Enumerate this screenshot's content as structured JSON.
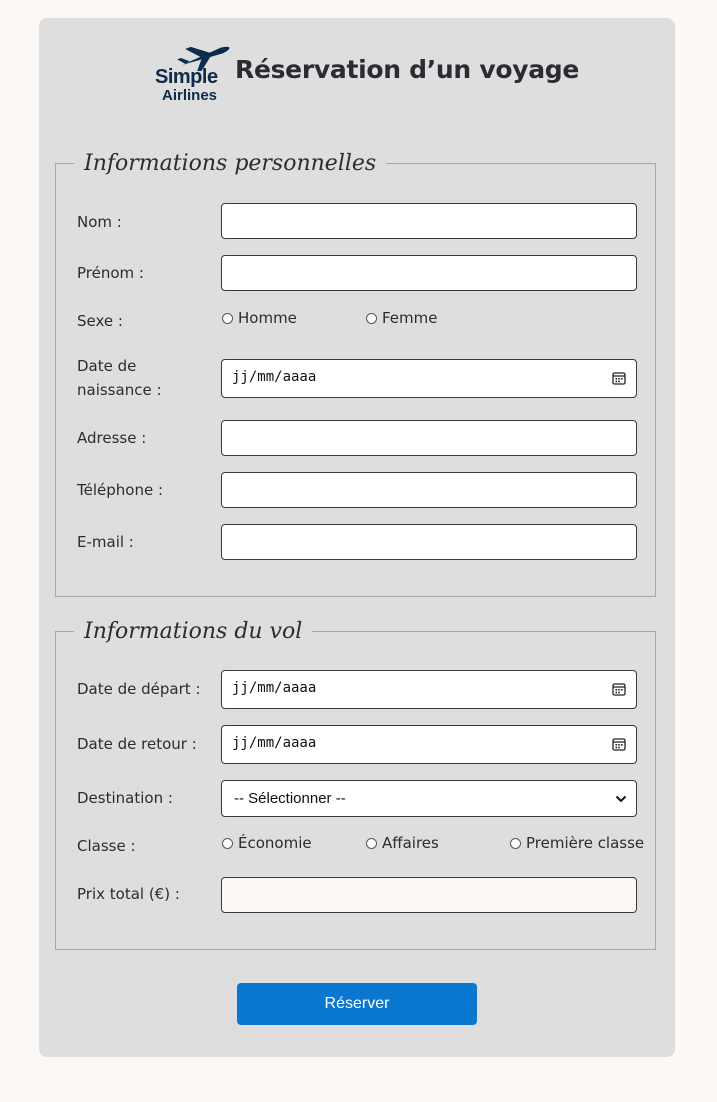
{
  "header": {
    "logo_line1": "Simple",
    "logo_line2": "Airlines",
    "title": "Réservation d’un voyage"
  },
  "personal": {
    "legend": "Informations personnelles",
    "nom_label": "Nom :",
    "prenom_label": "Prénom :",
    "sexe_label": "Sexe :",
    "sexe_options": [
      "Homme",
      "Femme"
    ],
    "naissance_label": "Date de naissance :",
    "naissance_placeholder": "jj/mm/aaaa",
    "adresse_label": "Adresse :",
    "telephone_label": "Téléphone :",
    "email_label": "E-mail :"
  },
  "flight": {
    "legend": "Informations du vol",
    "depart_label": "Date de départ :",
    "depart_placeholder": "jj/mm/aaaa",
    "retour_label": "Date de retour :",
    "retour_placeholder": "jj/mm/aaaa",
    "destination_label": "Destination :",
    "destination_selected": "-- Sélectionner --",
    "classe_label": "Classe :",
    "classe_options": [
      "Économie",
      "Affaires",
      "Première classe"
    ],
    "prix_label": "Prix total (€) :"
  },
  "actions": {
    "submit_label": "Réserver"
  },
  "colors": {
    "background": "#fcf8f5",
    "card": "#dedede",
    "button": "#0a78d0",
    "logo": "#0d2b4a"
  },
  "icons": {
    "logo": "plane-icon",
    "date_picker": "calendar-icon",
    "select": "chevron-down-icon"
  }
}
